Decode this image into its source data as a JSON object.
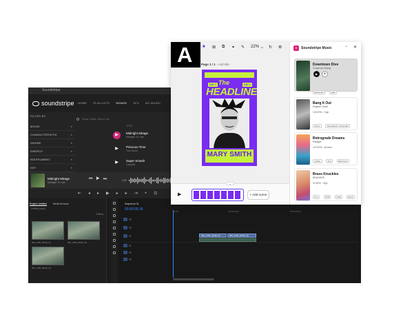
{
  "colors": {
    "accent": "#d7297e",
    "poster_purple": "#7a2cf2",
    "poster_lime": "#c6f23c",
    "timeline_blue": "#2d8bff"
  },
  "soundstripe_app": {
    "window_title": "Soundstripe",
    "logo_text": "soundstripe",
    "nav": [
      "HOME",
      "PLAYLISTS",
      "SONGS",
      "SFX",
      "MY MUSIC"
    ],
    "search_placeholder": "Song, Artist, Mood, etc.",
    "filter_header": "FILTER BY",
    "filters": [
      "MOOD",
      "CHARACTERISTIC",
      "GENRE",
      "ENERGY",
      "INSTRUMENT",
      "KEY"
    ],
    "col_title": "TITLE",
    "tracks": [
      {
        "title": "Midnight Mirage",
        "artist": "Midnight To Late"
      },
      {
        "title": "Precious Time",
        "artist": "Turo Moon"
      },
      {
        "title": "Super Smash",
        "artist": "Carpetbl"
      }
    ],
    "player": {
      "title": "Midnight Mirage",
      "artist": "Midnight To Late",
      "time_start": "0:00",
      "time_end": "3:48"
    }
  },
  "editor": {
    "project_tabs": [
      "Project: Untitled",
      "Media Browser"
    ],
    "project_sub": "Untitled.prproj",
    "item_count": "3 Items",
    "clips": [
      "IMG_1296_H0290_00...",
      "IMG_1296_H0291_00...",
      "IMG_1296_H0292_00..."
    ],
    "sequence_name": "Sequence 01",
    "timecode": "00:00:05:18",
    "ruler": [
      "00:00",
      "00:00:05:00",
      "00:00:10:00"
    ],
    "video_tracks": [
      "V3",
      "V2",
      "V1"
    ],
    "audio_tracks": [
      "A1",
      "A2",
      "A3"
    ],
    "timeline_clips": [
      "IMG_1296_H0290_00",
      "IMG_1296_H0291_00"
    ]
  },
  "adobe_express": {
    "zoom": "22%",
    "page_label_bold": "Page 1 / 1",
    "page_label_add": "- Add title",
    "poster": {
      "the": "The",
      "headline": "HEADLINER",
      "day_badge_1": "DAY 1",
      "day_badge_2": "DAY 2",
      "name": "MARY SMITH"
    },
    "add_scene": "+ Add scene"
  },
  "soundstripe_panel": {
    "title": "Soundstripe Music",
    "songs": [
      {
        "title": "Downtown Dive",
        "artist": "Gorgeous Dying",
        "meta": "143 BPM · Mid",
        "tags": [
          "Electronic",
          "Indie"
        ],
        "selected": true
      },
      {
        "title": "Bang It Out",
        "artist": "Rhythm Scott",
        "meta": "105 BPM · High",
        "tags": [
          "Score",
          "Soundtrack / Cinematic"
        ],
        "selected": false
      },
      {
        "title": "Retrograde Dreams",
        "artist": "Parlight",
        "meta": "100 BPM · Medium",
        "tags": [
          "Quirky",
          "Fun",
          "Electronic",
          "Indie"
        ],
        "selected": false
      },
      {
        "title": "Brass Knuckles",
        "artist": "BRASHEE",
        "meta": "94 BPM · High",
        "tags": [
          "Fun",
          "Chill",
          "Indie",
          "Rock"
        ],
        "selected": false
      }
    ]
  }
}
